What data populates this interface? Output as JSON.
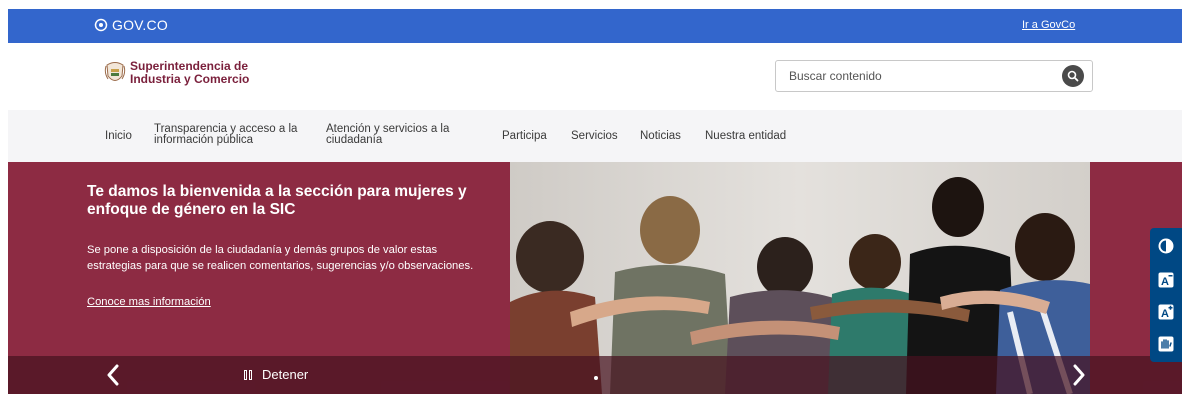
{
  "govbar": {
    "logo_text": "GOV.CO",
    "link_label": "Ir a GovCo"
  },
  "header": {
    "brand_line1": "Superintendencia de",
    "brand_line2": "Industria y Comercio",
    "search_placeholder": "Buscar contenido"
  },
  "nav": {
    "items": [
      {
        "label": "Inicio"
      },
      {
        "label": "Transparencia y acceso a la",
        "label2": "información pública"
      },
      {
        "label": "Atención y servicios a la",
        "label2": "ciudadanía"
      },
      {
        "label": "Participa"
      },
      {
        "label": "Servicios"
      },
      {
        "label": "Noticias"
      },
      {
        "label": "Nuestra entidad"
      }
    ]
  },
  "hero": {
    "title": "Te damos la bienvenida a la sección para mujeres y enfoque de género en la SIC",
    "description": "Se pone a disposición de la ciudadanía y demás grupos de valor estas estrategias para que se realicen comentarios, sugerencias y/o observaciones.",
    "link_label": "Conoce mas información",
    "pause_label": "Detener"
  },
  "colors": {
    "gov_blue": "#3366cc",
    "hero_maroon": "#8d2b43",
    "brand_maroon": "#7a1f3b",
    "a11y_blue": "#004884"
  },
  "icons": {
    "prev": "chevron-left-icon",
    "next": "chevron-right-icon",
    "pause": "pause-icon",
    "search": "search-icon",
    "contrast": "contrast-icon",
    "font_decrease": "font-decrease-icon",
    "font_increase": "font-increase-icon",
    "relay": "sign-language-icon"
  }
}
